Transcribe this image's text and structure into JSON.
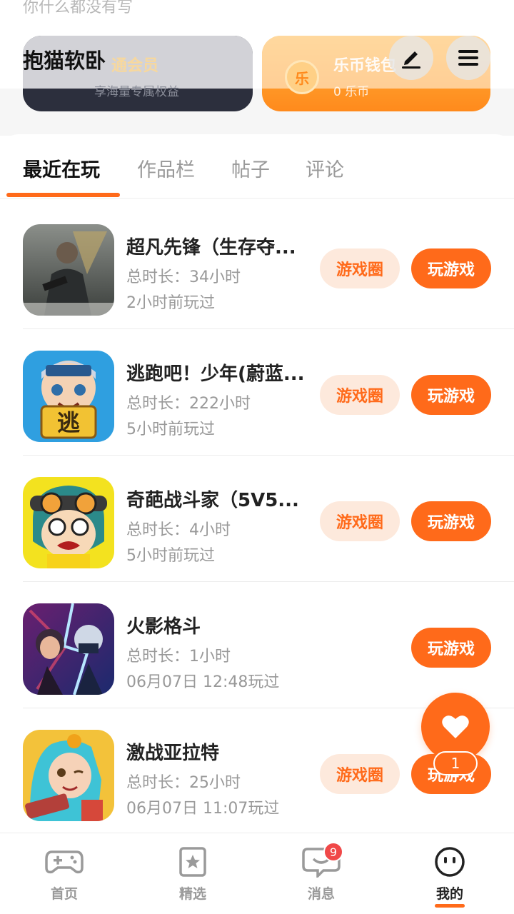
{
  "header": {
    "signature_text": "你什么都没有写",
    "username": "抱猫软卧",
    "vip_card": {
      "title": "通会员",
      "subtitle": "享海量专属权益"
    },
    "wallet_card": {
      "coin_glyph": "乐",
      "title": "乐币钱包",
      "subtitle": "0 乐币"
    }
  },
  "tabs": [
    "最近在玩",
    "作品栏",
    "帖子",
    "评论"
  ],
  "active_tab": "最近在玩",
  "games": [
    {
      "name": "超凡先锋（生存夺...",
      "duration": "总时长：34小时",
      "last_played": "2小时前玩过",
      "circle_label": "游戏圈",
      "play_label": "玩游戏"
    },
    {
      "name": "逃跑吧！少年(蔚蓝...",
      "duration": "总时长：222小时",
      "last_played": "5小时前玩过",
      "circle_label": "游戏圈",
      "play_label": "玩游戏"
    },
    {
      "name": "奇葩战斗家（5V5...",
      "duration": "总时长：4小时",
      "last_played": "5小时前玩过",
      "circle_label": "游戏圈",
      "play_label": "玩游戏"
    },
    {
      "name": "火影格斗",
      "duration": "总时长：1小时",
      "last_played": "06月07日 12:48玩过",
      "circle_label": "",
      "play_label": "玩游戏"
    },
    {
      "name": "激战亚拉特",
      "duration": "总时长：25小时",
      "last_played": "06月07日 11:07玩过",
      "circle_label": "游戏圈",
      "play_label": "玩游戏"
    }
  ],
  "floating": {
    "badge": "1"
  },
  "bottom_nav": [
    {
      "label": "首页",
      "icon": "gamepad-icon"
    },
    {
      "label": "精选",
      "icon": "star-bookmark-icon"
    },
    {
      "label": "消息",
      "icon": "chat-bubble-icon",
      "badge": "9"
    },
    {
      "label": "我的",
      "icon": "smiley-face-icon",
      "active": true
    }
  ],
  "colors": {
    "accent": "#ff6a1a",
    "accent_light": "#fde9dc",
    "badge_red": "#f04848"
  }
}
